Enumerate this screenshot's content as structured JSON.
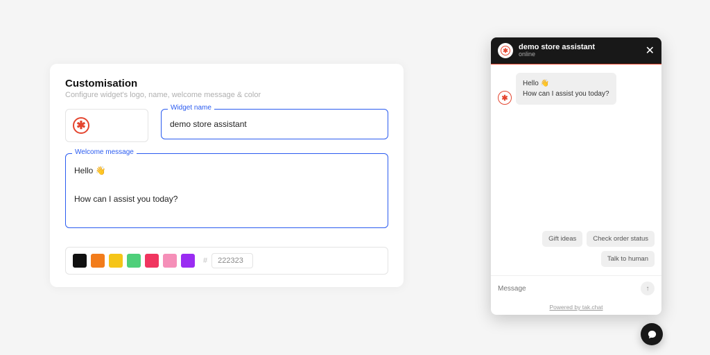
{
  "card": {
    "title": "Customisation",
    "subtitle": "Configure widget's logo, name, welcome message & color",
    "widget_name_label": "Widget name",
    "widget_name_value": "demo store assistant",
    "welcome_label": "Welcome message",
    "welcome_value": "Hello 👋\n\nHow can I assist you today?",
    "hex_value": "222323"
  },
  "colors": [
    "#111111",
    "#f27c1b",
    "#f5c518",
    "#4fcf7a",
    "#f0355f",
    "#f58fb8",
    "#9a2cf2"
  ],
  "chat": {
    "title": "demo store assistant",
    "status": "online",
    "greeting": "Hello 👋\nHow can I assist you today?",
    "chips": [
      "Gift ideas",
      "Check order status",
      "Talk to human"
    ],
    "placeholder": "Message",
    "powered": "Powered by tak.chat"
  }
}
